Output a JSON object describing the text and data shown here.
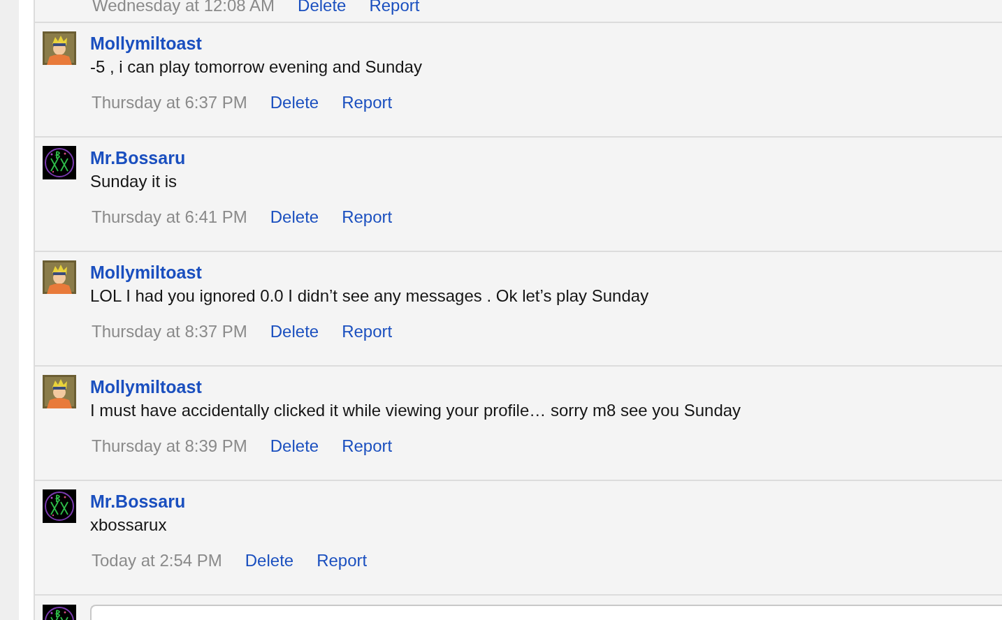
{
  "previous_message": {
    "time": "Wednesday at 12:08 AM",
    "actions": [
      "Delete",
      "Report"
    ]
  },
  "messages": [
    {
      "kind": "olive",
      "author": "Mollymiltoast",
      "text": "-5 , i can play tomorrow evening and Sunday",
      "time": "Thursday at 6:37 PM",
      "actions": [
        "Delete",
        "Report"
      ]
    },
    {
      "kind": "dark",
      "author": "Mr.Bossaru",
      "text": "Sunday it is",
      "time": "Thursday at 6:41 PM",
      "actions": [
        "Delete",
        "Report"
      ]
    },
    {
      "kind": "olive",
      "author": "Mollymiltoast",
      "text": "LOL I had you ignored 0.0 I didn’t see any messages . Ok let’s play Sunday",
      "time": "Thursday at 8:37 PM",
      "actions": [
        "Delete",
        "Report"
      ]
    },
    {
      "kind": "olive",
      "author": "Mollymiltoast",
      "text": "I must have accidentally clicked it while viewing your profile… sorry m8 see you Sunday",
      "time": "Thursday at 8:39 PM",
      "actions": [
        "Delete",
        "Report"
      ]
    },
    {
      "kind": "dark",
      "author": "Mr.Bossaru",
      "text": "xbossarux",
      "time": "Today at 2:54 PM",
      "actions": [
        "Delete",
        "Report"
      ]
    }
  ],
  "reply": {
    "kind": "dark"
  }
}
